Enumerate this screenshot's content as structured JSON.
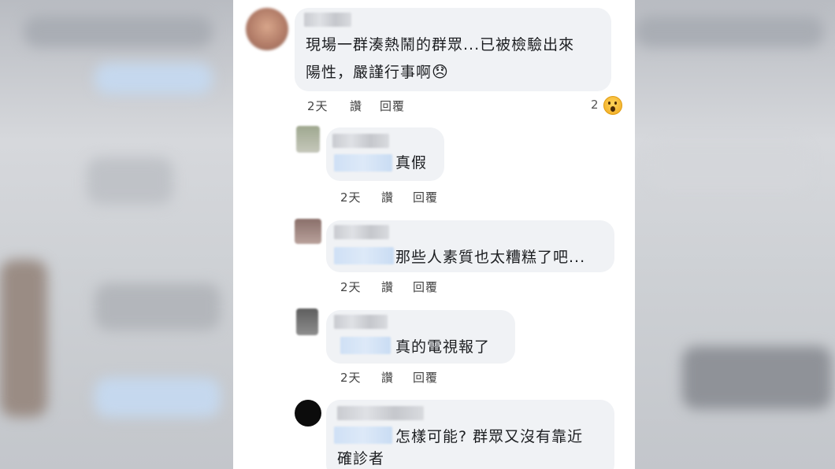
{
  "comments": [
    {
      "text_lines": [
        "現場一群湊熱鬧的群眾...已被檢驗出來",
        "陽性，嚴謹行事啊"
      ],
      "emoji": "😞",
      "time": "2天",
      "like": "讚",
      "reply": "回覆",
      "reaction_count": "2"
    },
    {
      "text_lines": [
        "真假"
      ],
      "time": "2天",
      "like": "讚",
      "reply": "回覆"
    },
    {
      "text_lines": [
        "那些人素質也太糟糕了吧..."
      ],
      "time": "2天",
      "like": "讚",
      "reply": "回覆"
    },
    {
      "text_lines": [
        "真的電視報了"
      ],
      "time": "2天",
      "like": "讚",
      "reply": "回覆"
    },
    {
      "text_lines": [
        "怎樣可能? 群眾又沒有靠近",
        "確診者"
      ]
    }
  ],
  "colors": {
    "bubble": "#f0f2f5",
    "text": "#1c1e21",
    "meta": "#444444"
  }
}
